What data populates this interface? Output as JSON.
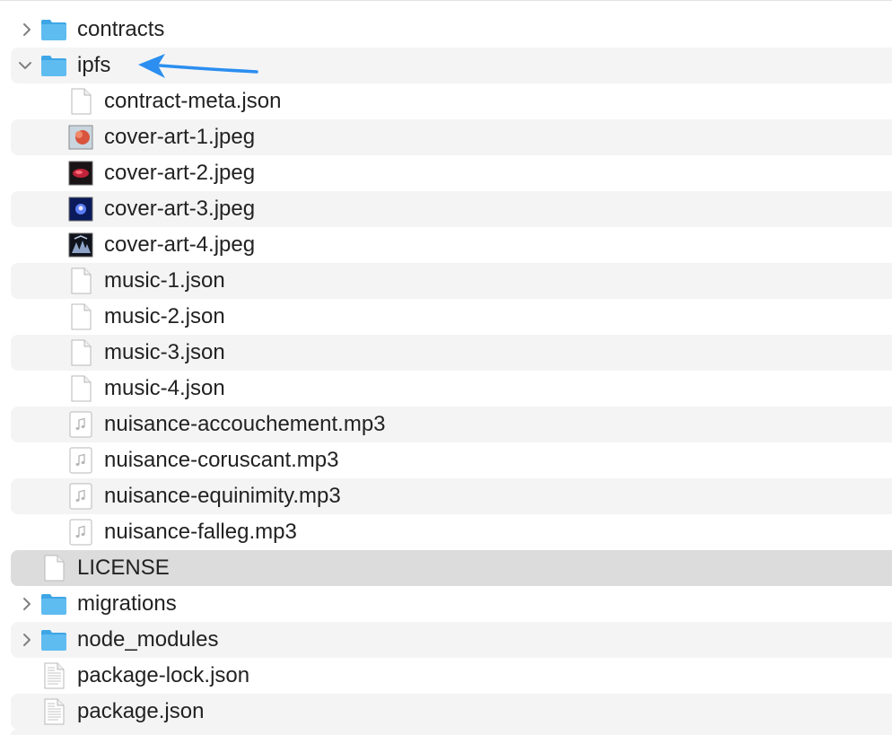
{
  "files": [
    {
      "name": "contracts",
      "kind": "folder",
      "expanded": false
    },
    {
      "name": "ipfs",
      "kind": "folder",
      "expanded": true
    },
    {
      "name": "contract-meta.json",
      "kind": "doc"
    },
    {
      "name": "cover-art-1.jpeg",
      "kind": "image",
      "thumb": "cover-art-1"
    },
    {
      "name": "cover-art-2.jpeg",
      "kind": "image",
      "thumb": "cover-art-2"
    },
    {
      "name": "cover-art-3.jpeg",
      "kind": "image",
      "thumb": "cover-art-3"
    },
    {
      "name": "cover-art-4.jpeg",
      "kind": "image",
      "thumb": "cover-art-4"
    },
    {
      "name": "music-1.json",
      "kind": "doc"
    },
    {
      "name": "music-2.json",
      "kind": "doc"
    },
    {
      "name": "music-3.json",
      "kind": "doc"
    },
    {
      "name": "music-4.json",
      "kind": "doc"
    },
    {
      "name": "nuisance-accouchement.mp3",
      "kind": "audio"
    },
    {
      "name": "nuisance-coruscant.mp3",
      "kind": "audio"
    },
    {
      "name": "nuisance-equinimity.mp3",
      "kind": "audio"
    },
    {
      "name": "nuisance-falleg.mp3",
      "kind": "audio"
    },
    {
      "name": "LICENSE",
      "kind": "doc",
      "selected": true
    },
    {
      "name": "migrations",
      "kind": "folder",
      "expanded": false
    },
    {
      "name": "node_modules",
      "kind": "folder",
      "expanded": false
    },
    {
      "name": "package-lock.json",
      "kind": "text"
    },
    {
      "name": "package.json",
      "kind": "text"
    }
  ],
  "colors": {
    "folder": "#5fbcf0",
    "folder_tab": "#3ea6e6",
    "arrow": "#2b8ef0",
    "row_alt": "#f4f4f5",
    "row_selected": "#dcdcdc"
  }
}
